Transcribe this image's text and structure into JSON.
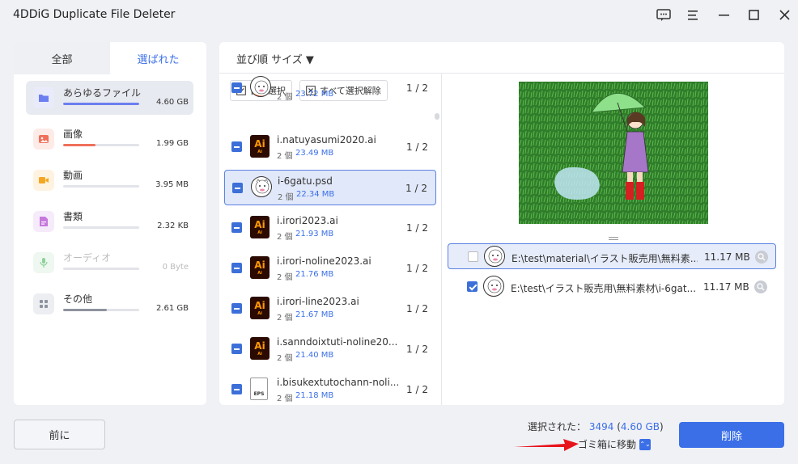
{
  "app": {
    "title": "4DDiG Duplicate File Deleter"
  },
  "left_panel": {
    "tabs": [
      {
        "label": "全部"
      },
      {
        "label": "選ばれた"
      }
    ],
    "categories": [
      {
        "name": "あらゆるファイル",
        "size": "4.60 GB",
        "icon": "folder-icon",
        "color": "#6b7ff0",
        "fill": 1.0,
        "selected": true
      },
      {
        "name": "画像",
        "size": "1.99 GB",
        "icon": "image-icon",
        "color": "#f0705a",
        "fill": 0.43
      },
      {
        "name": "動画",
        "size": "3.95 MB",
        "icon": "video-icon",
        "color": "#f5a623",
        "fill": 0.0
      },
      {
        "name": "書類",
        "size": "2.32 KB",
        "icon": "document-icon",
        "color": "#c678dd",
        "fill": 0.0
      },
      {
        "name": "オーディオ",
        "size": "0 Byte",
        "icon": "microphone-icon",
        "color": "#8ed19a",
        "fill": 0.0
      },
      {
        "name": "その他",
        "size": "2.61 GB",
        "icon": "grid-icon",
        "color": "#8e939e",
        "fill": 0.57
      }
    ]
  },
  "main": {
    "sort_label": "並び順 サイズ ▼",
    "toolbar": {
      "auto_select": "自動選択",
      "deselect_all": "すべて選択解除"
    },
    "files": [
      {
        "name": "",
        "count": "2 個",
        "size": "23.72 MB",
        "ratio": "1 / 2",
        "icon": "sheep"
      },
      {
        "name": "i.natuyasumi2020.ai",
        "count": "2 個",
        "size": "23.49 MB",
        "ratio": "1 / 2",
        "icon": "ai"
      },
      {
        "name": "i-6gatu.psd",
        "count": "2 個",
        "size": "22.34 MB",
        "ratio": "1 / 2",
        "icon": "sheep",
        "selected": true
      },
      {
        "name": "i.irori2023.ai",
        "count": "2 個",
        "size": "21.93 MB",
        "ratio": "1 / 2",
        "icon": "ai"
      },
      {
        "name": "i.irori-noline2023.ai",
        "count": "2 個",
        "size": "21.76 MB",
        "ratio": "1 / 2",
        "icon": "ai"
      },
      {
        "name": "i.irori-line2023.ai",
        "count": "2 個",
        "size": "21.67 MB",
        "ratio": "1 / 2",
        "icon": "ai"
      },
      {
        "name": "i.sanndoixtuti-noline20...",
        "count": "2 個",
        "size": "21.40 MB",
        "ratio": "1 / 2",
        "icon": "ai"
      },
      {
        "name": "i.bisukextutochann-noli...",
        "count": "2 個",
        "size": "21.18 MB",
        "ratio": "1 / 2",
        "icon": "eps"
      }
    ],
    "icon_text": {
      "ai": "Ai",
      "ai_sub": "Ai",
      "eps": "EPS"
    },
    "duplicates": [
      {
        "path": "E:\\test\\material\\イラスト販売用\\無料素...",
        "size": "11.17 MB",
        "checked": false,
        "selected": true
      },
      {
        "path": "E:\\test\\イラスト販売用\\無料素材\\i-6gat...",
        "size": "11.17 MB",
        "checked": true
      }
    ]
  },
  "footer": {
    "back_label": "前に",
    "selected_label": "選択された：",
    "selected_count": "3494",
    "selected_size": "4.60 GB",
    "paren_open": "(",
    "paren_close": ")",
    "action_label": "ゴミ箱に移動",
    "action_dropdown": "⌃⌄",
    "delete_label": "削除"
  },
  "colors": {
    "accent": "#3b6fe8",
    "arrow": "#e8141c"
  }
}
